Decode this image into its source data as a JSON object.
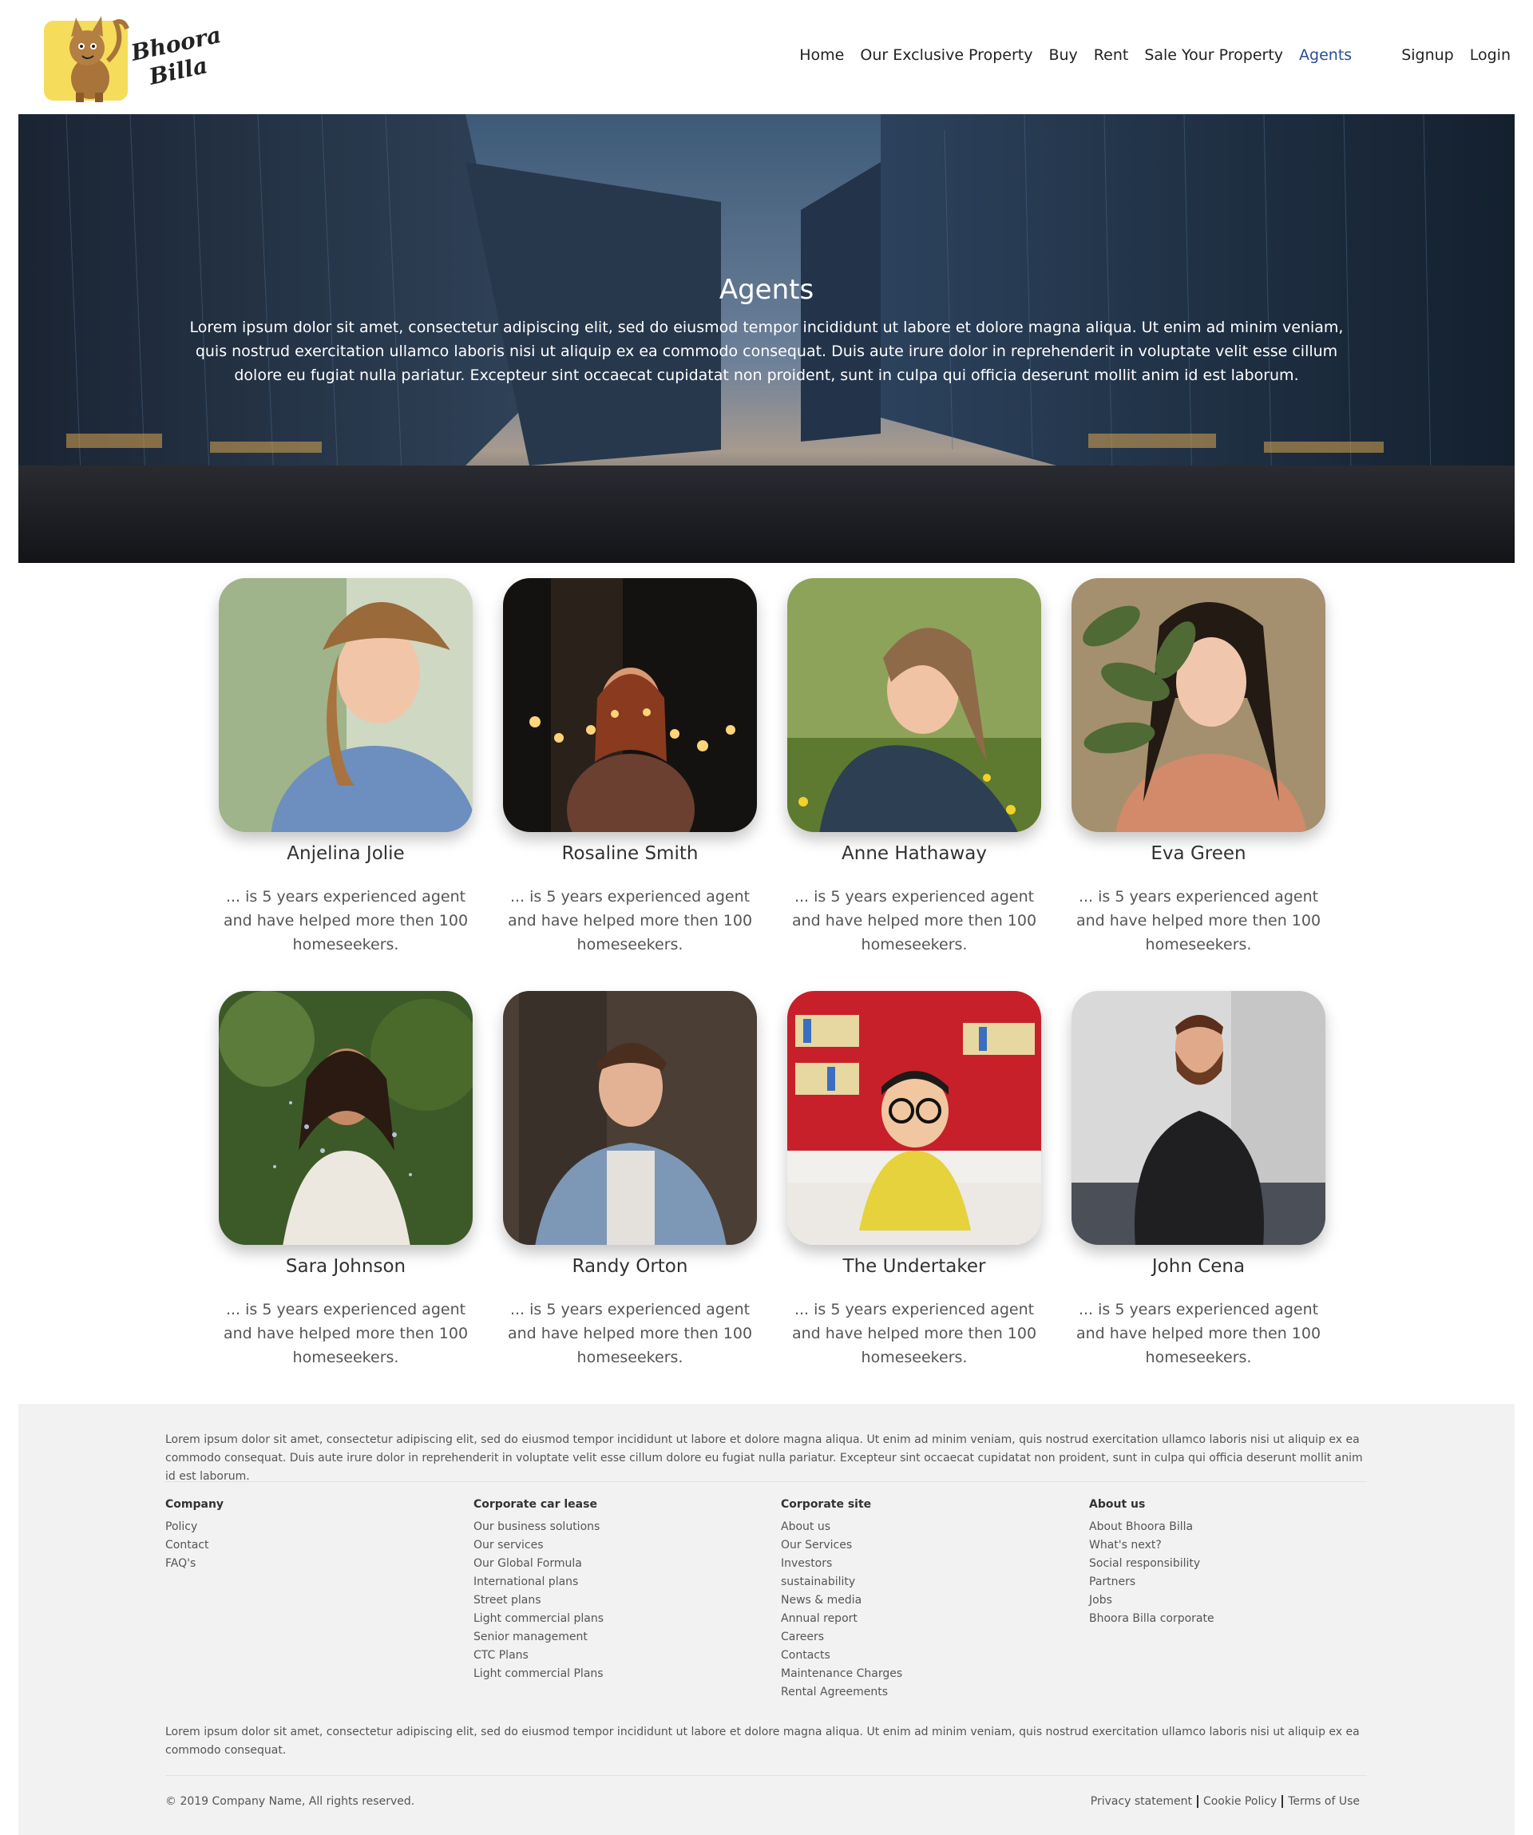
{
  "brand": {
    "line1": "Bhoora",
    "line2": "Billa"
  },
  "nav": {
    "items": [
      {
        "label": "Home"
      },
      {
        "label": "Our Exclusive Property"
      },
      {
        "label": "Buy"
      },
      {
        "label": "Rent"
      },
      {
        "label": "Sale Your Property"
      },
      {
        "label": "Agents"
      }
    ],
    "active": "Agents",
    "signup": "Signup",
    "login": "Login"
  },
  "hero": {
    "title": "Agents",
    "text": "Lorem ipsum dolor sit amet, consectetur adipiscing elit, sed do eiusmod tempor incididunt ut labore et dolore magna aliqua. Ut enim ad minim veniam, quis nostrud exercitation ullamco laboris nisi ut aliquip ex ea commodo consequat. Duis aute irure dolor in reprehenderit in voluptate velit esse cillum dolore eu fugiat nulla pariatur. Excepteur sint occaecat cupidatat non proident, sunt in culpa qui officia deserunt mollit anim id est laborum."
  },
  "agents": [
    {
      "name": "Anjelina Jolie",
      "desc": "... is 5 years experienced agent and have helped more then 100 homeseekers."
    },
    {
      "name": "Rosaline Smith",
      "desc": "... is 5 years experienced agent and have helped more then 100 homeseekers."
    },
    {
      "name": "Anne Hathaway",
      "desc": "... is 5 years experienced agent and have helped more then 100 homeseekers."
    },
    {
      "name": "Eva Green",
      "desc": "... is 5 years experienced agent and have helped more then 100 homeseekers."
    },
    {
      "name": "Sara Johnson",
      "desc": "... is 5 years experienced agent and have helped more then 100 homeseekers."
    },
    {
      "name": "Randy Orton",
      "desc": "... is 5 years experienced agent and have helped more then 100 homeseekers."
    },
    {
      "name": "The Undertaker",
      "desc": "... is 5 years experienced agent and have helped more then 100 homeseekers."
    },
    {
      "name": "John Cena",
      "desc": "... is 5 years experienced agent and have helped more then 100 homeseekers."
    }
  ],
  "footer": {
    "intro": "Lorem ipsum dolor sit amet, consectetur adipiscing elit, sed do eiusmod tempor incididunt ut labore et dolore magna aliqua. Ut enim ad minim veniam, quis nostrud exercitation ullamco laboris nisi ut aliquip ex ea commodo consequat. Duis aute irure dolor in reprehenderit in voluptate velit esse cillum dolore eu fugiat nulla pariatur. Excepteur sint occaecat cupidatat non proident, sunt in culpa qui officia deserunt mollit anim id est laborum.",
    "columns": [
      {
        "title": "Company",
        "links": [
          "Policy",
          "Contact",
          "FAQ's"
        ]
      },
      {
        "title": "Corporate car lease",
        "links": [
          "Our business solutions",
          "Our services",
          "Our Global Formula",
          "International plans",
          "Street plans",
          "Light commercial plans",
          "Senior management",
          "CTC Plans",
          "Light commercial Plans"
        ]
      },
      {
        "title": "Corporate site",
        "links": [
          "About us",
          "Our Services",
          "Investors",
          "sustainability",
          "News & media",
          "Annual report",
          "Careers",
          "Contacts",
          "Maintenance Charges",
          "Rental Agreements"
        ]
      },
      {
        "title": "About us",
        "links": [
          "About Bhoora Billa",
          "What's next?",
          "Social responsibility",
          "Partners",
          "Jobs",
          "Bhoora Billa corporate"
        ]
      }
    ],
    "note": "Lorem ipsum dolor sit amet, consectetur adipiscing elit, sed do eiusmod tempor incididunt ut labore et dolore magna aliqua. Ut enim ad minim veniam, quis nostrud exercitation ullamco laboris nisi ut aliquip ex ea commodo consequat.",
    "copyright": "© 2019 Company Name, All rights reserved.",
    "legal": [
      "Privacy statement",
      "Cookie Policy",
      "Terms of Use"
    ]
  }
}
